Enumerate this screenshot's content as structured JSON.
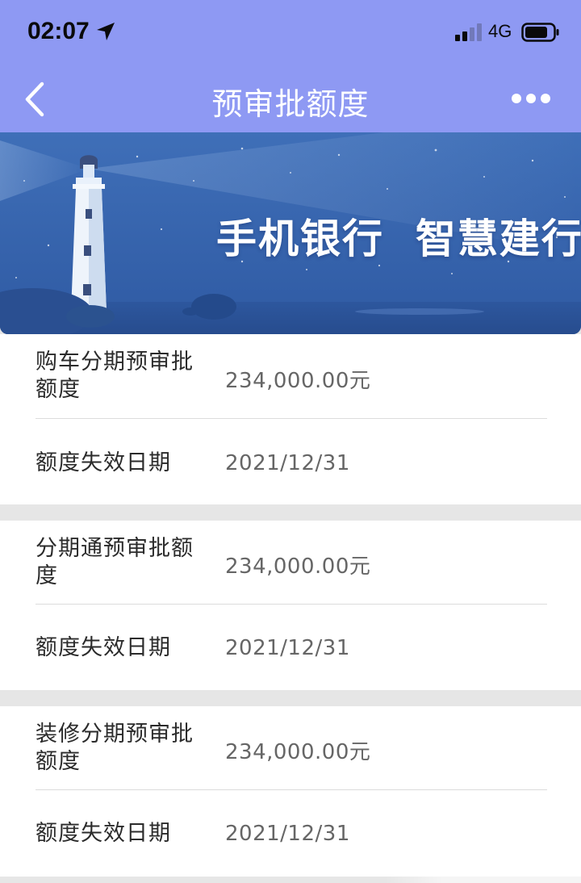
{
  "status_bar": {
    "time": "02:07",
    "network": "4G",
    "icons": [
      "location-arrow-icon",
      "signal-icon",
      "battery-icon"
    ]
  },
  "nav": {
    "title": "预审批额度",
    "back_icon": "chevron-left-icon",
    "more_icon": "more-dots-icon"
  },
  "banner": {
    "slogan_1": "手机银行",
    "slogan_2": "智慧建行"
  },
  "sections": [
    {
      "limit_label": "购车分期预审批额度",
      "limit_value": "234,000.00元",
      "expiry_label": "额度失效日期",
      "expiry_value": "2021/12/31"
    },
    {
      "limit_label": "分期通预审批额度",
      "limit_value": "234,000.00元",
      "expiry_label": "额度失效日期",
      "expiry_value": "2021/12/31"
    },
    {
      "limit_label": "装修分期预审批额度",
      "limit_value": "234,000.00元",
      "expiry_label": "额度失效日期",
      "expiry_value": "2021/12/31"
    }
  ],
  "colors": {
    "header_bg": "#8e99f3",
    "banner_bg": "#3a66b0",
    "page_bg": "#e6e6e6",
    "card_bg": "#ffffff",
    "label_text": "#2b2b2b",
    "value_text": "#666666"
  }
}
